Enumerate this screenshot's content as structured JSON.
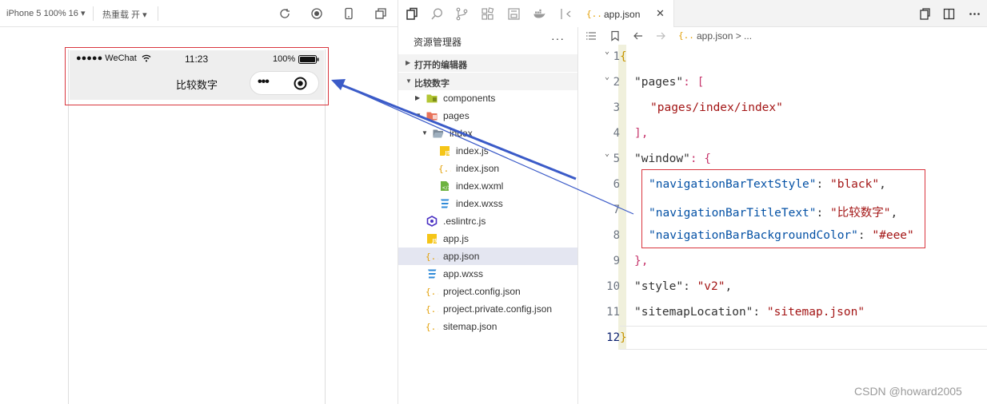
{
  "simulator": {
    "device_label": "iPhone 5 100% 16 ▾",
    "hotreload_label": "热重载 开 ▾",
    "status_bar": {
      "signal": "●●●●● WeChat",
      "time": "11:23",
      "battery": "100%"
    },
    "nav_title": "比较数字",
    "capsule_dots": "•••"
  },
  "explorer": {
    "title": "资源管理器",
    "more": "···",
    "open_editors": "打开的编辑器",
    "project_name": "比较数字",
    "tree": [
      {
        "label": "components",
        "type": "folder-components"
      },
      {
        "label": "pages",
        "type": "folder-pages"
      },
      {
        "label": "index",
        "type": "folder"
      },
      {
        "label": "index.js",
        "type": "js"
      },
      {
        "label": "index.json",
        "type": "json"
      },
      {
        "label": "index.wxml",
        "type": "wxml"
      },
      {
        "label": "index.wxss",
        "type": "wxss"
      },
      {
        "label": ".eslintrc.js",
        "type": "eslint"
      },
      {
        "label": "app.js",
        "type": "js"
      },
      {
        "label": "app.json",
        "type": "json"
      },
      {
        "label": "app.wxss",
        "type": "wxss"
      },
      {
        "label": "project.config.json",
        "type": "json"
      },
      {
        "label": "project.private.config.json",
        "type": "json"
      },
      {
        "label": "sitemap.json",
        "type": "json"
      }
    ],
    "selected": "app.json"
  },
  "editor": {
    "tab_label": "app.json",
    "tab_close": "✕",
    "breadcrumb": "app.json > ...",
    "line_numbers": [
      "1",
      "2",
      "3",
      "4",
      "5",
      "6",
      "7",
      "8",
      "9",
      "10",
      "11",
      "12"
    ],
    "current_line": "12",
    "code": {
      "l1": "{",
      "l2_key": "\"pages\"",
      "l2_rest": ": [",
      "l3": "\"pages/index/index\"",
      "l4": "],",
      "l5_key": "\"window\"",
      "l5_rest": ": {",
      "l6_key": "\"navigationBarTextStyle\"",
      "l6_val": "\"black\"",
      "l7_key": "\"navigationBarTitleText\"",
      "l7_val": "\"比较数字\"",
      "l8_key": "\"navigationBarBackgroundColor\"",
      "l8_val": "\"#eee\"",
      "l9": "},",
      "l10_key": "\"style\"",
      "l10_val": "\"v2\"",
      "l11_key": "\"sitemapLocation\"",
      "l11_val": "\"sitemap.json\"",
      "l12": "}",
      "colon": ": ",
      "comma": ","
    }
  },
  "watermark": "CSDN @howard2005",
  "colors": {
    "annotation_red": "#d9363e",
    "arrow_blue": "#3b5bc8",
    "nav_bg": "#eeeeee",
    "json_key": "#0451a5",
    "json_string": "#a31515"
  }
}
